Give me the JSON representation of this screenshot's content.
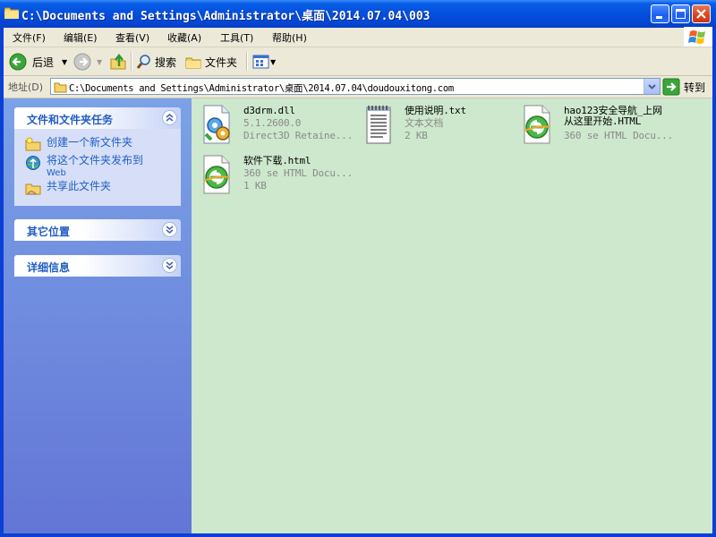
{
  "window": {
    "title": "C:\\Documents and Settings\\Administrator\\桌面\\2014.07.04\\003"
  },
  "menu": [
    "文件(F)",
    "编辑(E)",
    "查看(V)",
    "收藏(A)",
    "工具(T)",
    "帮助(H)"
  ],
  "toolbar": {
    "back_label": "后退",
    "search_label": "搜索",
    "folders_label": "文件夹"
  },
  "address": {
    "label": "地址(D)",
    "value": "C:\\Documents and Settings\\Administrator\\桌面\\2014.07.04\\doudouxitong.com",
    "go_label": "转到"
  },
  "taskpane": {
    "file_tasks": {
      "title": "文件和文件夹任务",
      "items": [
        {
          "label": "创建一个新文件夹",
          "icon": "new-folder-icon"
        },
        {
          "label": "将这个文件夹发布到",
          "sub": "Web",
          "icon": "publish-web-icon"
        },
        {
          "label": "共享此文件夹",
          "icon": "share-folder-icon"
        }
      ]
    },
    "other_places": {
      "title": "其它位置"
    },
    "details": {
      "title": "详细信息"
    }
  },
  "files": [
    {
      "name": "d3drm.dll",
      "line2": "5.1.2600.0",
      "line3": "Direct3D Retaine...",
      "icon": "dll-icon"
    },
    {
      "name": "使用说明.txt",
      "line2": "文本文档",
      "line3": "2 KB",
      "icon": "text-document-icon"
    },
    {
      "name": "hao123安全导航_上网",
      "name2": "从这里开始.HTML",
      "line3": "360 se HTML Docu...",
      "icon": "360se-html-icon"
    },
    {
      "name": "软件下载.html",
      "line2": "360 se HTML Docu...",
      "line3": "1 KB",
      "icon": "360se-html-icon"
    }
  ],
  "colors": {
    "titlebar": "#0450de",
    "content_bg": "#cde8cd",
    "taskpane": "#7ba2e7",
    "link": "#215dc6"
  }
}
